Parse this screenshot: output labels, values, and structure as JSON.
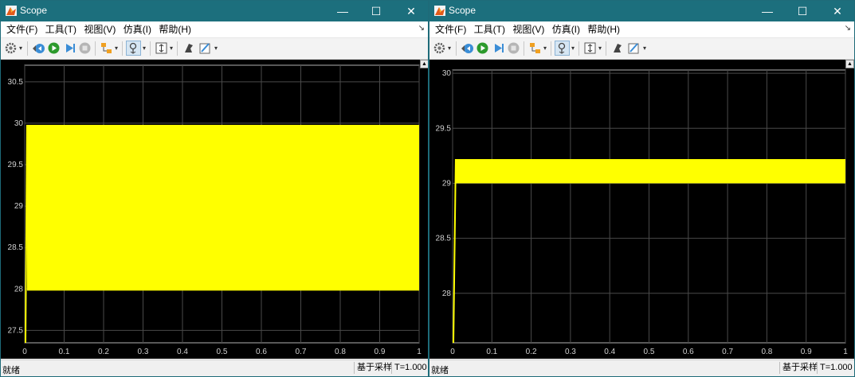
{
  "windows": [
    {
      "title": "Scope",
      "menu": [
        "文件(F)",
        "工具(T)",
        "视图(V)",
        "仿真(I)",
        "帮助(H)"
      ],
      "controls": {
        "minimize": "—",
        "maximize": "☐",
        "close": "✕"
      },
      "status": {
        "ready": "就绪",
        "sample_mode": "基于采样",
        "time": "T=1.000"
      },
      "chart_data": {
        "type": "area",
        "xlim": [
          0,
          1
        ],
        "ylim": [
          27.35,
          30.7
        ],
        "x_ticks": [
          "0",
          "0.1",
          "0.2",
          "0.3",
          "0.4",
          "0.5",
          "0.6",
          "0.7",
          "0.8",
          "0.9",
          "1"
        ],
        "y_ticks": [
          "27.5",
          "28",
          "28.5",
          "29",
          "29.5",
          "30",
          "30.5"
        ],
        "grid": true,
        "series": [
          {
            "color": "#ffff00",
            "band_upper": 29.98,
            "band_lower": 27.98,
            "startup_x": 0.006
          }
        ]
      }
    },
    {
      "title": "Scope",
      "menu": [
        "文件(F)",
        "工具(T)",
        "视图(V)",
        "仿真(I)",
        "帮助(H)"
      ],
      "controls": {
        "minimize": "—",
        "maximize": "☐",
        "close": "✕"
      },
      "status": {
        "ready": "就绪",
        "sample_mode": "基于采样",
        "time": "T=1.000"
      },
      "chart_data": {
        "type": "area",
        "xlim": [
          0,
          1
        ],
        "ylim": [
          27.55,
          30.03
        ],
        "x_ticks": [
          "0",
          "0.1",
          "0.2",
          "0.3",
          "0.4",
          "0.5",
          "0.6",
          "0.7",
          "0.8",
          "0.9",
          "1"
        ],
        "y_ticks": [
          "28",
          "28.5",
          "29",
          "29.5",
          "30"
        ],
        "grid": true,
        "series": [
          {
            "color": "#ffff00",
            "band_upper": 29.22,
            "band_lower": 29.0,
            "startup_x": 0.008
          }
        ]
      }
    }
  ]
}
